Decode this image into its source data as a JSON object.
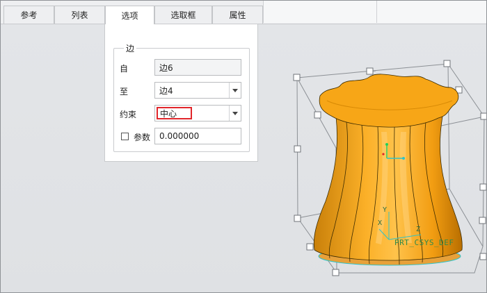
{
  "tabs": [
    {
      "label": "参考"
    },
    {
      "label": "列表"
    },
    {
      "label": "选项"
    },
    {
      "label": "选取框"
    },
    {
      "label": "属性"
    }
  ],
  "panel": {
    "group_title": "边",
    "from": {
      "label": "自",
      "value": "边6"
    },
    "to": {
      "label": "至",
      "value": "边4"
    },
    "constraint": {
      "label": "约束",
      "value": "中心"
    },
    "param": {
      "label": "参数",
      "value": "0.000000",
      "checked": false
    }
  },
  "viewport": {
    "csys_label": "PRT_CSYS_DEF",
    "axis_labels": {
      "x": "X",
      "y": "Y",
      "z": "Z"
    },
    "model_color": "#f7a10a",
    "model_shade": "#c57a00"
  }
}
